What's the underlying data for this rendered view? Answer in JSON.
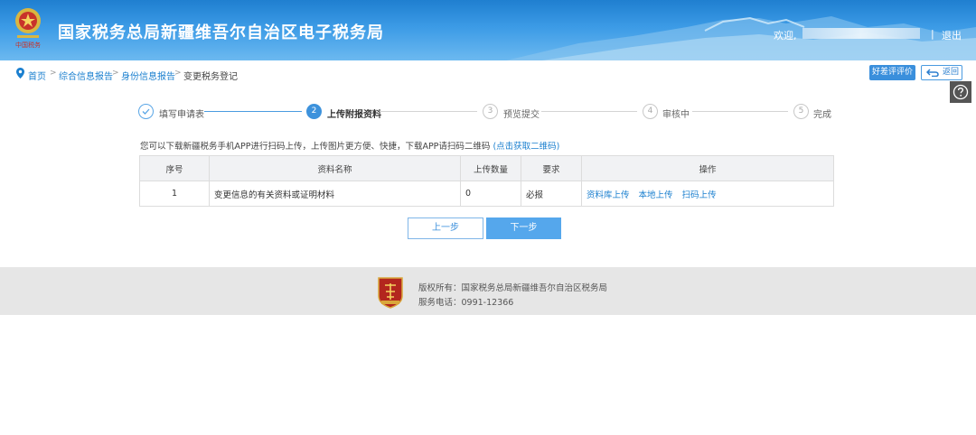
{
  "header": {
    "title": "国家税务总局新疆维吾尔自治区电子税务局",
    "welcome": "欢迎,",
    "separator": "|",
    "logout": "退出",
    "emblem_icon": "tax-emblem-icon",
    "brand_color": "#2586d6"
  },
  "breadcrumb": {
    "items": [
      "首页",
      "综合信息报告",
      "身份信息报告",
      "变更税务登记"
    ],
    "separator": ">"
  },
  "toolbar": {
    "rate_label": "好差评评价",
    "back_label": "返回",
    "help_icon": "help-icon"
  },
  "steps": [
    {
      "number": "1",
      "label": "填写申请表",
      "state": "done"
    },
    {
      "number": "2",
      "label": "上传附报资料",
      "state": "active"
    },
    {
      "number": "3",
      "label": "预览提交",
      "state": "todo"
    },
    {
      "number": "4",
      "label": "审核中",
      "state": "todo"
    },
    {
      "number": "5",
      "label": "完成",
      "state": "todo"
    }
  ],
  "notice": {
    "text": "您可以下载新疆税务手机APP进行扫码上传，上传图片更方便、快捷，下载APP请扫码二维码",
    "link": "(点击获取二维码)"
  },
  "table": {
    "headers": [
      "序号",
      "资料名称",
      "上传数量",
      "要求",
      "操作"
    ],
    "rows": [
      {
        "index": "1",
        "name": "变更信息的有关资料或证明材料",
        "count": "0",
        "requirement": "必报",
        "actions": [
          "资料库上传",
          "本地上传",
          "扫码上传"
        ]
      }
    ]
  },
  "buttons": {
    "prev": "上一步",
    "next": "下一步"
  },
  "footer": {
    "copyright": "版权所有：国家税务总局新疆维吾尔自治区税务局",
    "phone": "服务电话：0991-12366",
    "logo_icon": "tax-shield-logo-icon"
  }
}
